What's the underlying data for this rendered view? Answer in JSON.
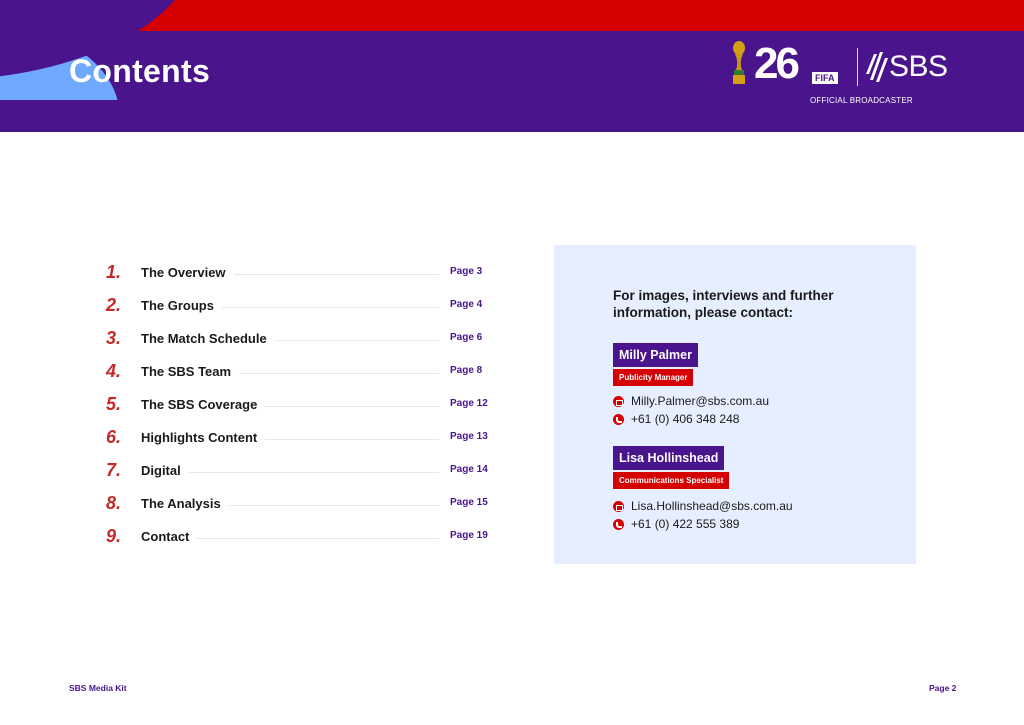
{
  "header": {
    "title": "Contents",
    "logo": {
      "year_mark": "26",
      "fifa_tag": "FIFA",
      "broadcaster_name": "SBS",
      "tagline": "OFFICIAL BROADCASTER",
      "icons": [
        "world-cup-trophy-icon",
        "sbs-logo-icon"
      ]
    },
    "colors": {
      "primary": "#4a148c",
      "accent_red": "#d50000",
      "accent_blue": "#6fa8ff"
    }
  },
  "toc": {
    "items": [
      {
        "number": "1.",
        "label": "The Overview",
        "page": "Page 3"
      },
      {
        "number": "2.",
        "label": "The Groups",
        "page": "Page 4"
      },
      {
        "number": "3.",
        "label": "The Match Schedule",
        "page": "Page 6"
      },
      {
        "number": "4.",
        "label": "The SBS Team",
        "page": "Page 8"
      },
      {
        "number": "5.",
        "label": "The SBS Coverage",
        "page": "Page 12"
      },
      {
        "number": "6.",
        "label": "Highlights Content",
        "page": "Page 13"
      },
      {
        "number": "7.",
        "label": "Digital",
        "page": "Page 14"
      },
      {
        "number": "8.",
        "label": "The Analysis",
        "page": "Page 15"
      },
      {
        "number": "9.",
        "label": "Contact",
        "page": "Page 19"
      }
    ]
  },
  "contact": {
    "heading": "For images, interviews and further information, please contact:",
    "people": [
      {
        "name": "Milly Palmer",
        "role": "Publicity Manager",
        "email": "Milly.Palmer@sbs.com.au",
        "phone": "+61 (0) 406 348 248"
      },
      {
        "name": "Lisa Hollinshead",
        "role": "Communications Specialist",
        "email": "Lisa.Hollinshead@sbs.com.au",
        "phone": "+61 (0) 422 555 389"
      }
    ]
  },
  "footer": {
    "left": "SBS Media Kit",
    "right": "Page 2"
  }
}
